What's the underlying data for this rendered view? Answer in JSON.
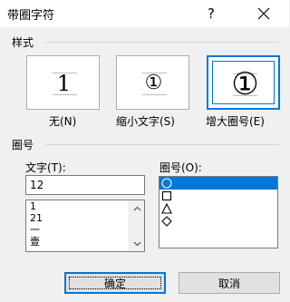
{
  "window": {
    "title": "带圈字符",
    "help_label": "?",
    "close_icon": "close-icon"
  },
  "style_section": {
    "label": "样式",
    "options": [
      {
        "caption": "无(N)",
        "preview": "1",
        "selected": false
      },
      {
        "caption": "缩小文字(S)",
        "preview": "①",
        "selected": false
      },
      {
        "caption": "增大圈号(E)",
        "preview": "①",
        "selected": true
      }
    ]
  },
  "enclosure_section": {
    "label": "圈号",
    "text_label": "文字(T):",
    "text_value": "12",
    "text_list": [
      "1",
      "21",
      "一",
      "壹"
    ],
    "enclosure_label": "圈号(O):",
    "enclosures": [
      {
        "shape": "circle",
        "selected": true
      },
      {
        "shape": "square",
        "selected": false
      },
      {
        "shape": "triangle",
        "selected": false
      },
      {
        "shape": "diamond",
        "selected": false
      }
    ]
  },
  "buttons": {
    "ok_label": "确定",
    "cancel_label": "取消"
  },
  "colors": {
    "accent": "#0078d7",
    "background": "#f0f0f0"
  }
}
